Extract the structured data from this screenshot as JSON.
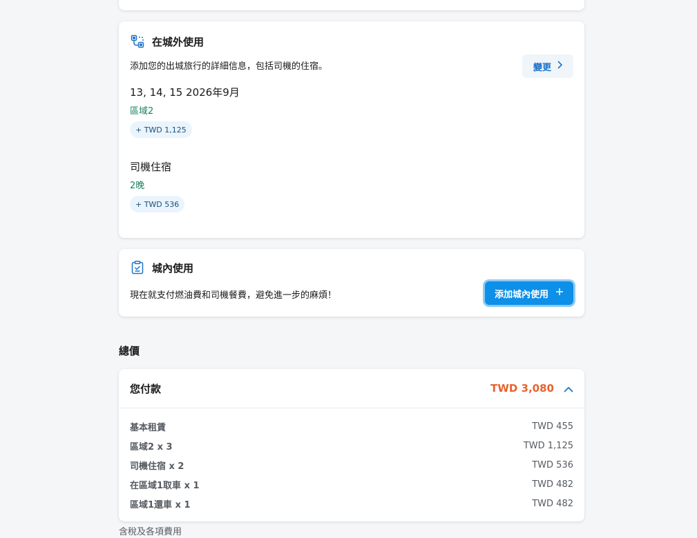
{
  "outside": {
    "title": "在城外使用",
    "description": "添加您的出城旅行的詳細信息，包括司機的住宿。",
    "change_label": "變更",
    "dates": "13, 14, 15 2026年9月",
    "zone": "區域2",
    "zone_price": "+ TWD 1,125",
    "lodging_title": "司機住宿",
    "nights": "2晚",
    "lodging_price": "+ TWD 536"
  },
  "inside": {
    "title": "城內使用",
    "description": "現在就支付燃油費和司機餐費，避免進一步的麻煩！",
    "add_label": "添加城內使用"
  },
  "total": {
    "heading": "總價",
    "pay_label": "您付款",
    "pay_amount": "TWD 3,080",
    "items": [
      {
        "label": "基本租賃",
        "value": "TWD 455"
      },
      {
        "label": "區域2 x 3",
        "value": "TWD 1,125"
      },
      {
        "label": "司機住宿 x 2",
        "value": "TWD 536"
      },
      {
        "label": "在區域1取車 x 1",
        "value": "TWD 482"
      },
      {
        "label": "區域1還車 x 1",
        "value": "TWD 482"
      }
    ],
    "footnote": "含稅及各項費用"
  },
  "colors": {
    "accent": "#0e8fe8",
    "link": "#1a73c8",
    "price": "#e8622c",
    "green": "#17825a"
  }
}
